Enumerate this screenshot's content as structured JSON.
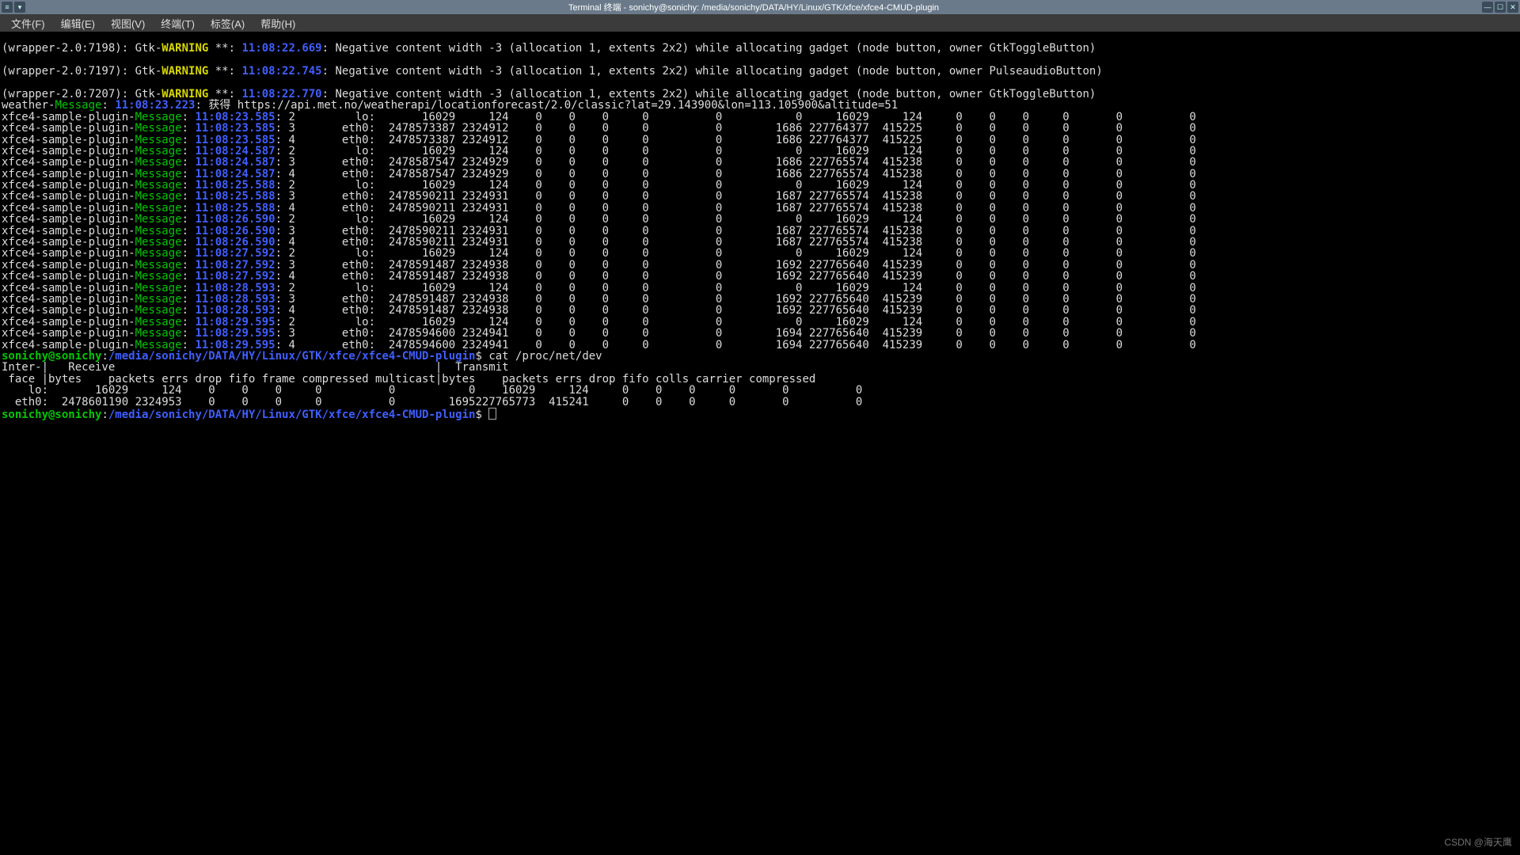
{
  "title_prefix": "Terminal 终端",
  "title_path": "sonichy@sonichy: /media/sonichy/DATA/HY/Linux/GTK/xfce/xfce4-CMUD-plugin",
  "menubar": [
    "文件(F)",
    "编辑(E)",
    "视图(V)",
    "终端(T)",
    "标签(A)",
    "帮助(H)"
  ],
  "wrappers": [
    {
      "pid": "7198",
      "ts": "11:08:22.669",
      "msg": "Negative content width -3 (allocation 1, extents 2x2) while allocating gadget (node button, owner GtkToggleButton)"
    },
    {
      "pid": "7197",
      "ts": "11:08:22.745",
      "msg": "Negative content width -3 (allocation 1, extents 2x2) while allocating gadget (node button, owner PulseaudioButton)"
    },
    {
      "pid": "7207",
      "ts": "11:08:22.770",
      "msg": "Negative content width -3 (allocation 1, extents 2x2) while allocating gadget (node button, owner GtkToggleButton)"
    }
  ],
  "weather": {
    "ts": "11:08:23.223",
    "text": "获得 https://api.met.no/weatherapi/locationforecast/2.0/classic?lat=29.143900&lon=113.105900&altitude=51"
  },
  "plugin_prefix": "xfce4-sample-plugin-",
  "plugin_tag": "Message",
  "samples": [
    {
      "ts": "11:08:23.585",
      "idx": "2",
      "iface": "lo:",
      "r": [
        "16029",
        "124",
        "0",
        "0",
        "0",
        "0",
        "0",
        "0"
      ],
      "t": [
        "16029",
        "124",
        "0",
        "0",
        "0",
        "0",
        "0",
        "0"
      ]
    },
    {
      "ts": "11:08:23.585",
      "idx": "3",
      "iface": "eth0:",
      "r": [
        "2478573387",
        "2324912",
        "0",
        "0",
        "0",
        "0",
        "0",
        "1686"
      ],
      "t": [
        "227764377",
        "415225",
        "0",
        "0",
        "0",
        "0",
        "0",
        "0"
      ]
    },
    {
      "ts": "11:08:23.585",
      "idx": "4",
      "iface": "eth0:",
      "r": [
        "2478573387",
        "2324912",
        "0",
        "0",
        "0",
        "0",
        "0",
        "1686"
      ],
      "t": [
        "227764377",
        "415225",
        "0",
        "0",
        "0",
        "0",
        "0",
        "0"
      ]
    },
    {
      "ts": "11:08:24.587",
      "idx": "2",
      "iface": "lo:",
      "r": [
        "16029",
        "124",
        "0",
        "0",
        "0",
        "0",
        "0",
        "0"
      ],
      "t": [
        "16029",
        "124",
        "0",
        "0",
        "0",
        "0",
        "0",
        "0"
      ]
    },
    {
      "ts": "11:08:24.587",
      "idx": "3",
      "iface": "eth0:",
      "r": [
        "2478587547",
        "2324929",
        "0",
        "0",
        "0",
        "0",
        "0",
        "1686"
      ],
      "t": [
        "227765574",
        "415238",
        "0",
        "0",
        "0",
        "0",
        "0",
        "0"
      ]
    },
    {
      "ts": "11:08:24.587",
      "idx": "4",
      "iface": "eth0:",
      "r": [
        "2478587547",
        "2324929",
        "0",
        "0",
        "0",
        "0",
        "0",
        "1686"
      ],
      "t": [
        "227765574",
        "415238",
        "0",
        "0",
        "0",
        "0",
        "0",
        "0"
      ]
    },
    {
      "ts": "11:08:25.588",
      "idx": "2",
      "iface": "lo:",
      "r": [
        "16029",
        "124",
        "0",
        "0",
        "0",
        "0",
        "0",
        "0"
      ],
      "t": [
        "16029",
        "124",
        "0",
        "0",
        "0",
        "0",
        "0",
        "0"
      ]
    },
    {
      "ts": "11:08:25.588",
      "idx": "3",
      "iface": "eth0:",
      "r": [
        "2478590211",
        "2324931",
        "0",
        "0",
        "0",
        "0",
        "0",
        "1687"
      ],
      "t": [
        "227765574",
        "415238",
        "0",
        "0",
        "0",
        "0",
        "0",
        "0"
      ]
    },
    {
      "ts": "11:08:25.588",
      "idx": "4",
      "iface": "eth0:",
      "r": [
        "2478590211",
        "2324931",
        "0",
        "0",
        "0",
        "0",
        "0",
        "1687"
      ],
      "t": [
        "227765574",
        "415238",
        "0",
        "0",
        "0",
        "0",
        "0",
        "0"
      ]
    },
    {
      "ts": "11:08:26.590",
      "idx": "2",
      "iface": "lo:",
      "r": [
        "16029",
        "124",
        "0",
        "0",
        "0",
        "0",
        "0",
        "0"
      ],
      "t": [
        "16029",
        "124",
        "0",
        "0",
        "0",
        "0",
        "0",
        "0"
      ]
    },
    {
      "ts": "11:08:26.590",
      "idx": "3",
      "iface": "eth0:",
      "r": [
        "2478590211",
        "2324931",
        "0",
        "0",
        "0",
        "0",
        "0",
        "1687"
      ],
      "t": [
        "227765574",
        "415238",
        "0",
        "0",
        "0",
        "0",
        "0",
        "0"
      ]
    },
    {
      "ts": "11:08:26.590",
      "idx": "4",
      "iface": "eth0:",
      "r": [
        "2478590211",
        "2324931",
        "0",
        "0",
        "0",
        "0",
        "0",
        "1687"
      ],
      "t": [
        "227765574",
        "415238",
        "0",
        "0",
        "0",
        "0",
        "0",
        "0"
      ]
    },
    {
      "ts": "11:08:27.592",
      "idx": "2",
      "iface": "lo:",
      "r": [
        "16029",
        "124",
        "0",
        "0",
        "0",
        "0",
        "0",
        "0"
      ],
      "t": [
        "16029",
        "124",
        "0",
        "0",
        "0",
        "0",
        "0",
        "0"
      ]
    },
    {
      "ts": "11:08:27.592",
      "idx": "3",
      "iface": "eth0:",
      "r": [
        "2478591487",
        "2324938",
        "0",
        "0",
        "0",
        "0",
        "0",
        "1692"
      ],
      "t": [
        "227765640",
        "415239",
        "0",
        "0",
        "0",
        "0",
        "0",
        "0"
      ]
    },
    {
      "ts": "11:08:27.592",
      "idx": "4",
      "iface": "eth0:",
      "r": [
        "2478591487",
        "2324938",
        "0",
        "0",
        "0",
        "0",
        "0",
        "1692"
      ],
      "t": [
        "227765640",
        "415239",
        "0",
        "0",
        "0",
        "0",
        "0",
        "0"
      ]
    },
    {
      "ts": "11:08:28.593",
      "idx": "2",
      "iface": "lo:",
      "r": [
        "16029",
        "124",
        "0",
        "0",
        "0",
        "0",
        "0",
        "0"
      ],
      "t": [
        "16029",
        "124",
        "0",
        "0",
        "0",
        "0",
        "0",
        "0"
      ]
    },
    {
      "ts": "11:08:28.593",
      "idx": "3",
      "iface": "eth0:",
      "r": [
        "2478591487",
        "2324938",
        "0",
        "0",
        "0",
        "0",
        "0",
        "1692"
      ],
      "t": [
        "227765640",
        "415239",
        "0",
        "0",
        "0",
        "0",
        "0",
        "0"
      ]
    },
    {
      "ts": "11:08:28.593",
      "idx": "4",
      "iface": "eth0:",
      "r": [
        "2478591487",
        "2324938",
        "0",
        "0",
        "0",
        "0",
        "0",
        "1692"
      ],
      "t": [
        "227765640",
        "415239",
        "0",
        "0",
        "0",
        "0",
        "0",
        "0"
      ]
    },
    {
      "ts": "11:08:29.595",
      "idx": "2",
      "iface": "lo:",
      "r": [
        "16029",
        "124",
        "0",
        "0",
        "0",
        "0",
        "0",
        "0"
      ],
      "t": [
        "16029",
        "124",
        "0",
        "0",
        "0",
        "0",
        "0",
        "0"
      ]
    },
    {
      "ts": "11:08:29.595",
      "idx": "3",
      "iface": "eth0:",
      "r": [
        "2478594600",
        "2324941",
        "0",
        "0",
        "0",
        "0",
        "0",
        "1694"
      ],
      "t": [
        "227765640",
        "415239",
        "0",
        "0",
        "0",
        "0",
        "0",
        "0"
      ]
    },
    {
      "ts": "11:08:29.595",
      "idx": "4",
      "iface": "eth0:",
      "r": [
        "2478594600",
        "2324941",
        "0",
        "0",
        "0",
        "0",
        "0",
        "1694"
      ],
      "t": [
        "227765640",
        "415239",
        "0",
        "0",
        "0",
        "0",
        "0",
        "0"
      ]
    }
  ],
  "prompt": {
    "user": "sonichy@sonichy",
    "path": "/media/sonichy/DATA/HY/Linux/GTK/xfce/xfce4-CMUD-plugin",
    "cmd": "cat /proc/net/dev"
  },
  "netdev_header1": "Inter-|   Receive                                                |  Transmit",
  "netdev_header2": " face |bytes    packets errs drop fifo frame compressed multicast|bytes    packets errs drop fifo colls carrier compressed",
  "netdev_rows": [
    {
      "iface": "lo:",
      "vals": [
        "16029",
        "124",
        "0",
        "0",
        "0",
        "0",
        "0",
        "0",
        "16029",
        "124",
        "0",
        "0",
        "0",
        "0",
        "0",
        "0"
      ]
    },
    {
      "iface": "eth0:",
      "vals": [
        "2478601190",
        "2324953",
        "0",
        "0",
        "0",
        "0",
        "0",
        "1695",
        "227765773",
        "415241",
        "0",
        "0",
        "0",
        "0",
        "0",
        "0"
      ]
    }
  ],
  "watermark": "CSDN @海天鹰"
}
